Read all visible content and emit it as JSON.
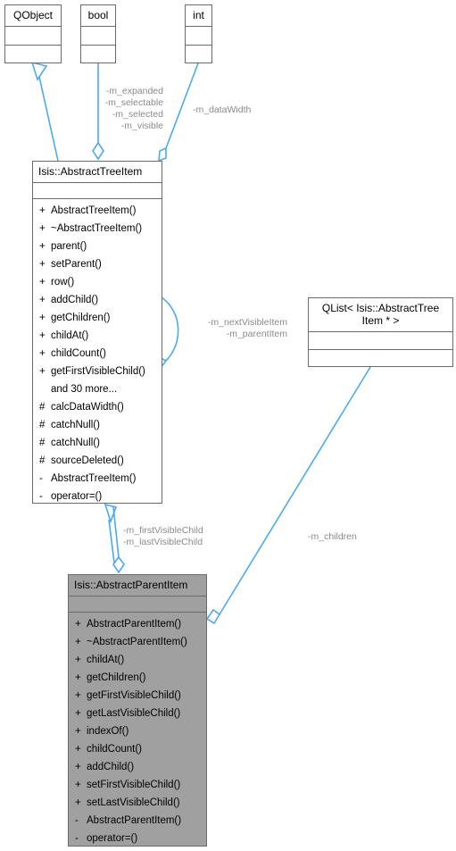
{
  "diagram": {
    "title": "Isis::AbstractParentItem class hierarchy",
    "type": "uml-class-diagram",
    "accent_color": "#4aaaf0",
    "box_border_color": "#6b6b6b",
    "focus_fill": "#a0a0a0",
    "label_color": "#8a8a8a"
  },
  "boxes": {
    "qobject": {
      "title": "QObject",
      "attributes": [],
      "operations": []
    },
    "bool": {
      "title": "bool",
      "attributes": [],
      "operations": []
    },
    "int": {
      "title": "int",
      "attributes": [],
      "operations": []
    },
    "abstract_tree_item": {
      "title": "Isis::AbstractTreeItem",
      "attributes": [],
      "operations": [
        {
          "visibility": "+",
          "name": "AbstractTreeItem()"
        },
        {
          "visibility": "+",
          "name": "~AbstractTreeItem()"
        },
        {
          "visibility": "+",
          "name": "parent()"
        },
        {
          "visibility": "+",
          "name": "setParent()"
        },
        {
          "visibility": "+",
          "name": "row()"
        },
        {
          "visibility": "+",
          "name": "addChild()"
        },
        {
          "visibility": "+",
          "name": "getChildren()"
        },
        {
          "visibility": "+",
          "name": "childAt()"
        },
        {
          "visibility": "+",
          "name": "childCount()"
        },
        {
          "visibility": "+",
          "name": "getFirstVisibleChild()"
        },
        {
          "visibility": "",
          "name": "and 30 more..."
        },
        {
          "visibility": "#",
          "name": "calcDataWidth()"
        },
        {
          "visibility": "#",
          "name": "catchNull()"
        },
        {
          "visibility": "#",
          "name": "catchNull()"
        },
        {
          "visibility": "#",
          "name": "sourceDeleted()"
        },
        {
          "visibility": "-",
          "name": "AbstractTreeItem()"
        },
        {
          "visibility": "-",
          "name": "operator=()"
        }
      ]
    },
    "qlist": {
      "title": "QList< Isis::AbstractTree\nItem * >",
      "attributes": [],
      "operations": []
    },
    "abstract_parent_item": {
      "title": "Isis::AbstractParentItem",
      "attributes": [],
      "operations": [
        {
          "visibility": "+",
          "name": "AbstractParentItem()"
        },
        {
          "visibility": "+",
          "name": "~AbstractParentItem()"
        },
        {
          "visibility": "+",
          "name": "childAt()"
        },
        {
          "visibility": "+",
          "name": "getChildren()"
        },
        {
          "visibility": "+",
          "name": "getFirstVisibleChild()"
        },
        {
          "visibility": "+",
          "name": "getLastVisibleChild()"
        },
        {
          "visibility": "+",
          "name": "indexOf()"
        },
        {
          "visibility": "+",
          "name": "childCount()"
        },
        {
          "visibility": "+",
          "name": "addChild()"
        },
        {
          "visibility": "+",
          "name": "setFirstVisibleChild()"
        },
        {
          "visibility": "+",
          "name": "setLastVisibleChild()"
        },
        {
          "visibility": "-",
          "name": "AbstractParentItem()"
        },
        {
          "visibility": "-",
          "name": "operator=()"
        }
      ]
    }
  },
  "edge_labels": {
    "bool_fields": "-m_expanded\n-m_selectable\n-m_selected\n-m_visible",
    "int_field": "-m_dataWidth",
    "self_fields": "-m_nextVisibleItem\n-m_parentItem",
    "child_fields": "-m_firstVisibleChild\n-m_lastVisibleChild",
    "children_field": "-m_children"
  }
}
